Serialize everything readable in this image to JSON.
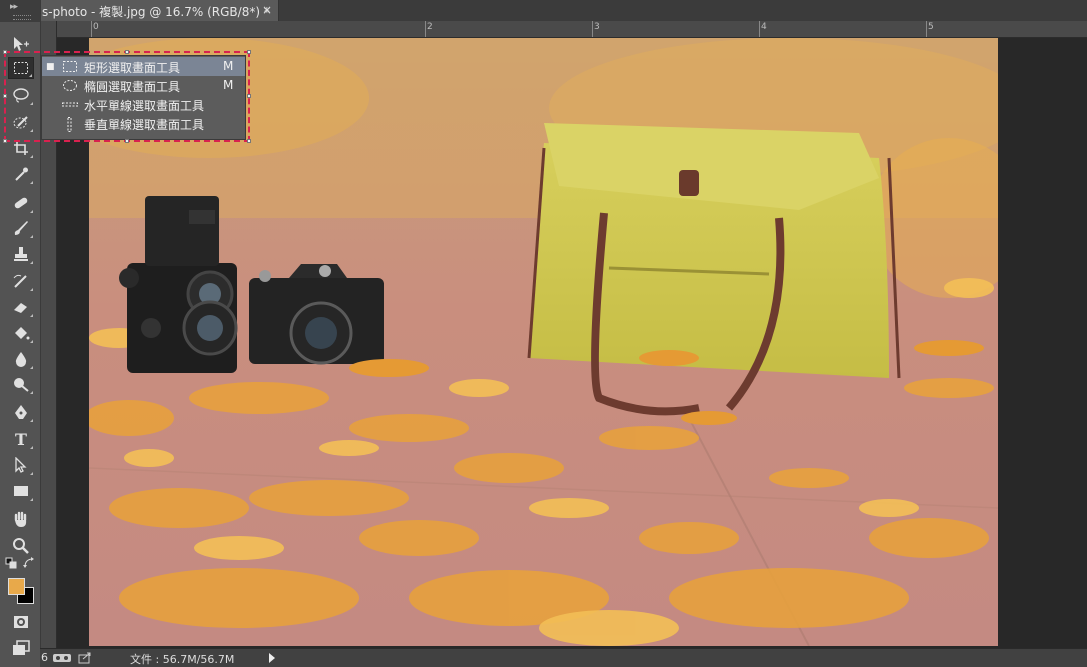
{
  "tab": {
    "title": "s-photo - 複製.jpg @ 16.7% (RGB/8*) *",
    "close_label": "×"
  },
  "ruler": {
    "h_labels": [
      "0",
      "1",
      "2",
      "3",
      "4",
      "5"
    ]
  },
  "tool_flyout": {
    "items": [
      {
        "label": "矩形選取畫面工具",
        "shortcut": "M",
        "selected": true,
        "icon": "rect-marquee-icon"
      },
      {
        "label": "橢圓選取畫面工具",
        "shortcut": "M",
        "selected": false,
        "icon": "ellipse-marquee-icon"
      },
      {
        "label": "水平單線選取畫面工具",
        "shortcut": "",
        "selected": false,
        "icon": "single-row-marquee-icon"
      },
      {
        "label": "垂直單線選取畫面工具",
        "shortcut": "",
        "selected": false,
        "icon": "single-column-marquee-icon"
      }
    ],
    "selected_marker": "■"
  },
  "toolbar": {
    "text_tool_glyph": "T",
    "collapse_glyph": "▸▸",
    "foreground_color": "#e8a94a",
    "background_color": "#000000"
  },
  "statusbar": {
    "zoom_fragment": "6",
    "doc_info": "文件 : 56.7M/56.7M"
  },
  "colors": {
    "highlight_border": "#d8224f",
    "selection_bg": "#7b8595"
  }
}
